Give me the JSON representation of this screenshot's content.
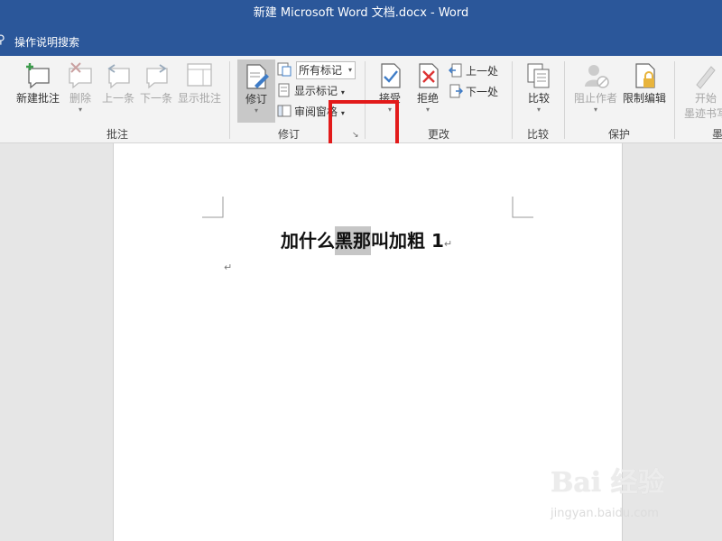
{
  "window": {
    "title": "新建 Microsoft Word 文档.docx  -  Word"
  },
  "tellme": {
    "icon": "lightbulb-icon",
    "text": "操作说明搜索"
  },
  "ribbon": {
    "comments_group": {
      "label": "批注",
      "new_comment": "新建批注",
      "delete": "删除",
      "previous": "上一条",
      "next": "下一条",
      "show_comments": "显示批注"
    },
    "tracking_group": {
      "label": "修订",
      "track_changes": "修订",
      "markup_dropdown": "所有标记",
      "show_markup": "显示标记",
      "reviewing_pane": "审阅窗格"
    },
    "changes_group": {
      "label": "更改",
      "accept": "接受",
      "reject": "拒绝",
      "previous": "上一处",
      "next": "下一处"
    },
    "compare_group": {
      "label": "比较",
      "compare": "比较"
    },
    "protect_group": {
      "label": "保护",
      "block_authors": "阻止作者",
      "restrict_editing": "限制编辑"
    },
    "ink_group": {
      "start_line1": "开始",
      "start_line2": "墨迹书写",
      "label_partial": "墨"
    }
  },
  "document": {
    "title_before": "加什么",
    "title_selected": "黑那",
    "title_after": "叫加粗 1",
    "paragraph_mark": "↵"
  },
  "watermark": {
    "brand": "Bai 经验",
    "url": "jingyan.baidu.com"
  },
  "colors": {
    "titlebar": "#2b579a",
    "highlight": "#e21a1a",
    "ribbon_bg": "#f3f3f3",
    "selection": "#c6c6c6"
  }
}
